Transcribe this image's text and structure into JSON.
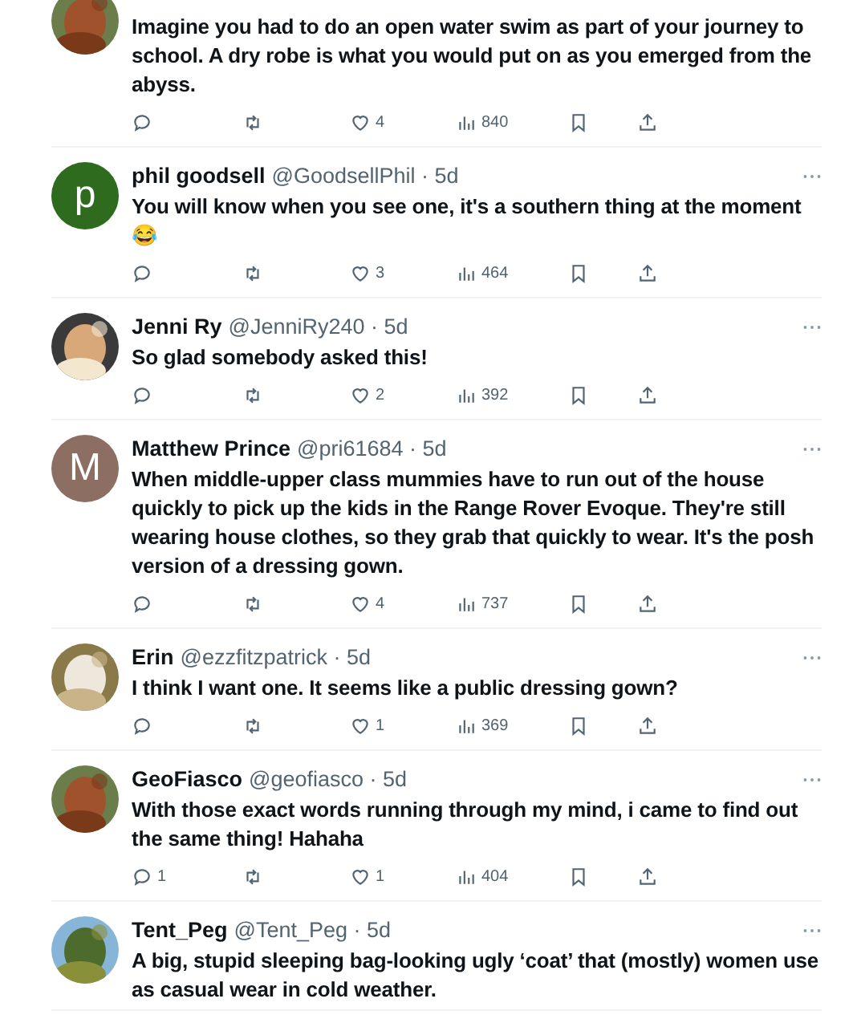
{
  "tweets": [
    {
      "text": "Imagine you had to do an open water swim as part of your journey to school. A dry robe is what you would put on as you emerged from the abyss.",
      "like_count": "4",
      "views": "840"
    },
    {
      "name": "phil goodsell",
      "handle": "@GoodsellPhil · 5d",
      "text": "You will know when you see one, it's a southern thing at the moment 😂",
      "avatar": {
        "kind": "letter",
        "letter": "p",
        "color": "#2f6b1f"
      },
      "like_count": "3",
      "views": "464"
    },
    {
      "name": "Jenni Ry",
      "handle": "@JenniRy240 · 5d",
      "text": "So glad somebody asked this!",
      "like_count": "2",
      "views": "392"
    },
    {
      "name": "Matthew Prince",
      "handle": "@pri61684 · 5d",
      "text": "When middle-upper class mummies have to run out of the house quickly to pick up the kids in the Range Rover Evoque. They're still wearing house clothes, so they grab that quickly to wear. It's the posh version of a dressing gown.",
      "avatar": {
        "kind": "letter",
        "letter": "M",
        "color": "#8d6e63"
      },
      "like_count": "4",
      "views": "737"
    },
    {
      "name": "Erin",
      "handle": "@ezzfitzpatrick · 5d",
      "text": "I think I want one. It seems like a public dressing gown?",
      "like_count": "1",
      "views": "369"
    },
    {
      "name": "GeoFiasco",
      "handle": "@geofiasco · 5d",
      "text": "With those exact words running through my mind, i came to find out the same thing! Hahaha",
      "reply_count": "1",
      "like_count": "1",
      "views": "404"
    },
    {
      "name": "Tent_Peg",
      "handle": "@Tent_Peg · 5d",
      "text": "A big, stupid sleeping bag-looking ugly ‘coat’ that (mostly) women use as casual wear in cold weather."
    }
  ]
}
